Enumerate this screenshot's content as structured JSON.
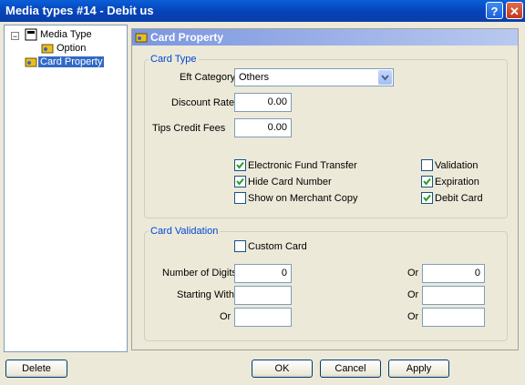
{
  "window": {
    "title": "Media types #14 - Debit us",
    "help": "?",
    "close": "✕"
  },
  "tree": {
    "items": [
      {
        "label": "Media Type"
      },
      {
        "label": "Option"
      },
      {
        "label": "Card Property"
      }
    ],
    "expander": "−"
  },
  "panel": {
    "title": "Card Property"
  },
  "card_type": {
    "legend": "Card Type",
    "eft_category": {
      "label": "Eft Category",
      "value": "Others"
    },
    "discount_rate": {
      "label": "Discount Rate",
      "value": "0.00"
    },
    "tips_credit_fees": {
      "label": "Tips Credit Fees",
      "value": "0.00"
    },
    "checkboxes": [
      {
        "label": "Electronic Fund Transfer",
        "checked": true
      },
      {
        "label": "Hide Card Number",
        "checked": true
      },
      {
        "label": "Show on Merchant Copy",
        "checked": false
      },
      {
        "label": "Validation",
        "checked": false
      },
      {
        "label": "Expiration",
        "checked": true
      },
      {
        "label": "Debit Card",
        "checked": true
      }
    ]
  },
  "card_validation": {
    "legend": "Card Validation",
    "custom_card": {
      "label": "Custom Card",
      "checked": false
    },
    "number_of_digits": {
      "label": "Number of Digits",
      "value": "0",
      "or_label": "Or",
      "or_value": "0"
    },
    "starting_with": {
      "label": "Starting With",
      "value": "",
      "or_label": "Or",
      "or_value": ""
    },
    "or_row": {
      "label": "Or",
      "value": "",
      "or_label": "Or",
      "or_value": ""
    }
  },
  "buttons": {
    "delete": "Delete",
    "ok": "OK",
    "cancel": "Cancel",
    "apply": "Apply"
  }
}
